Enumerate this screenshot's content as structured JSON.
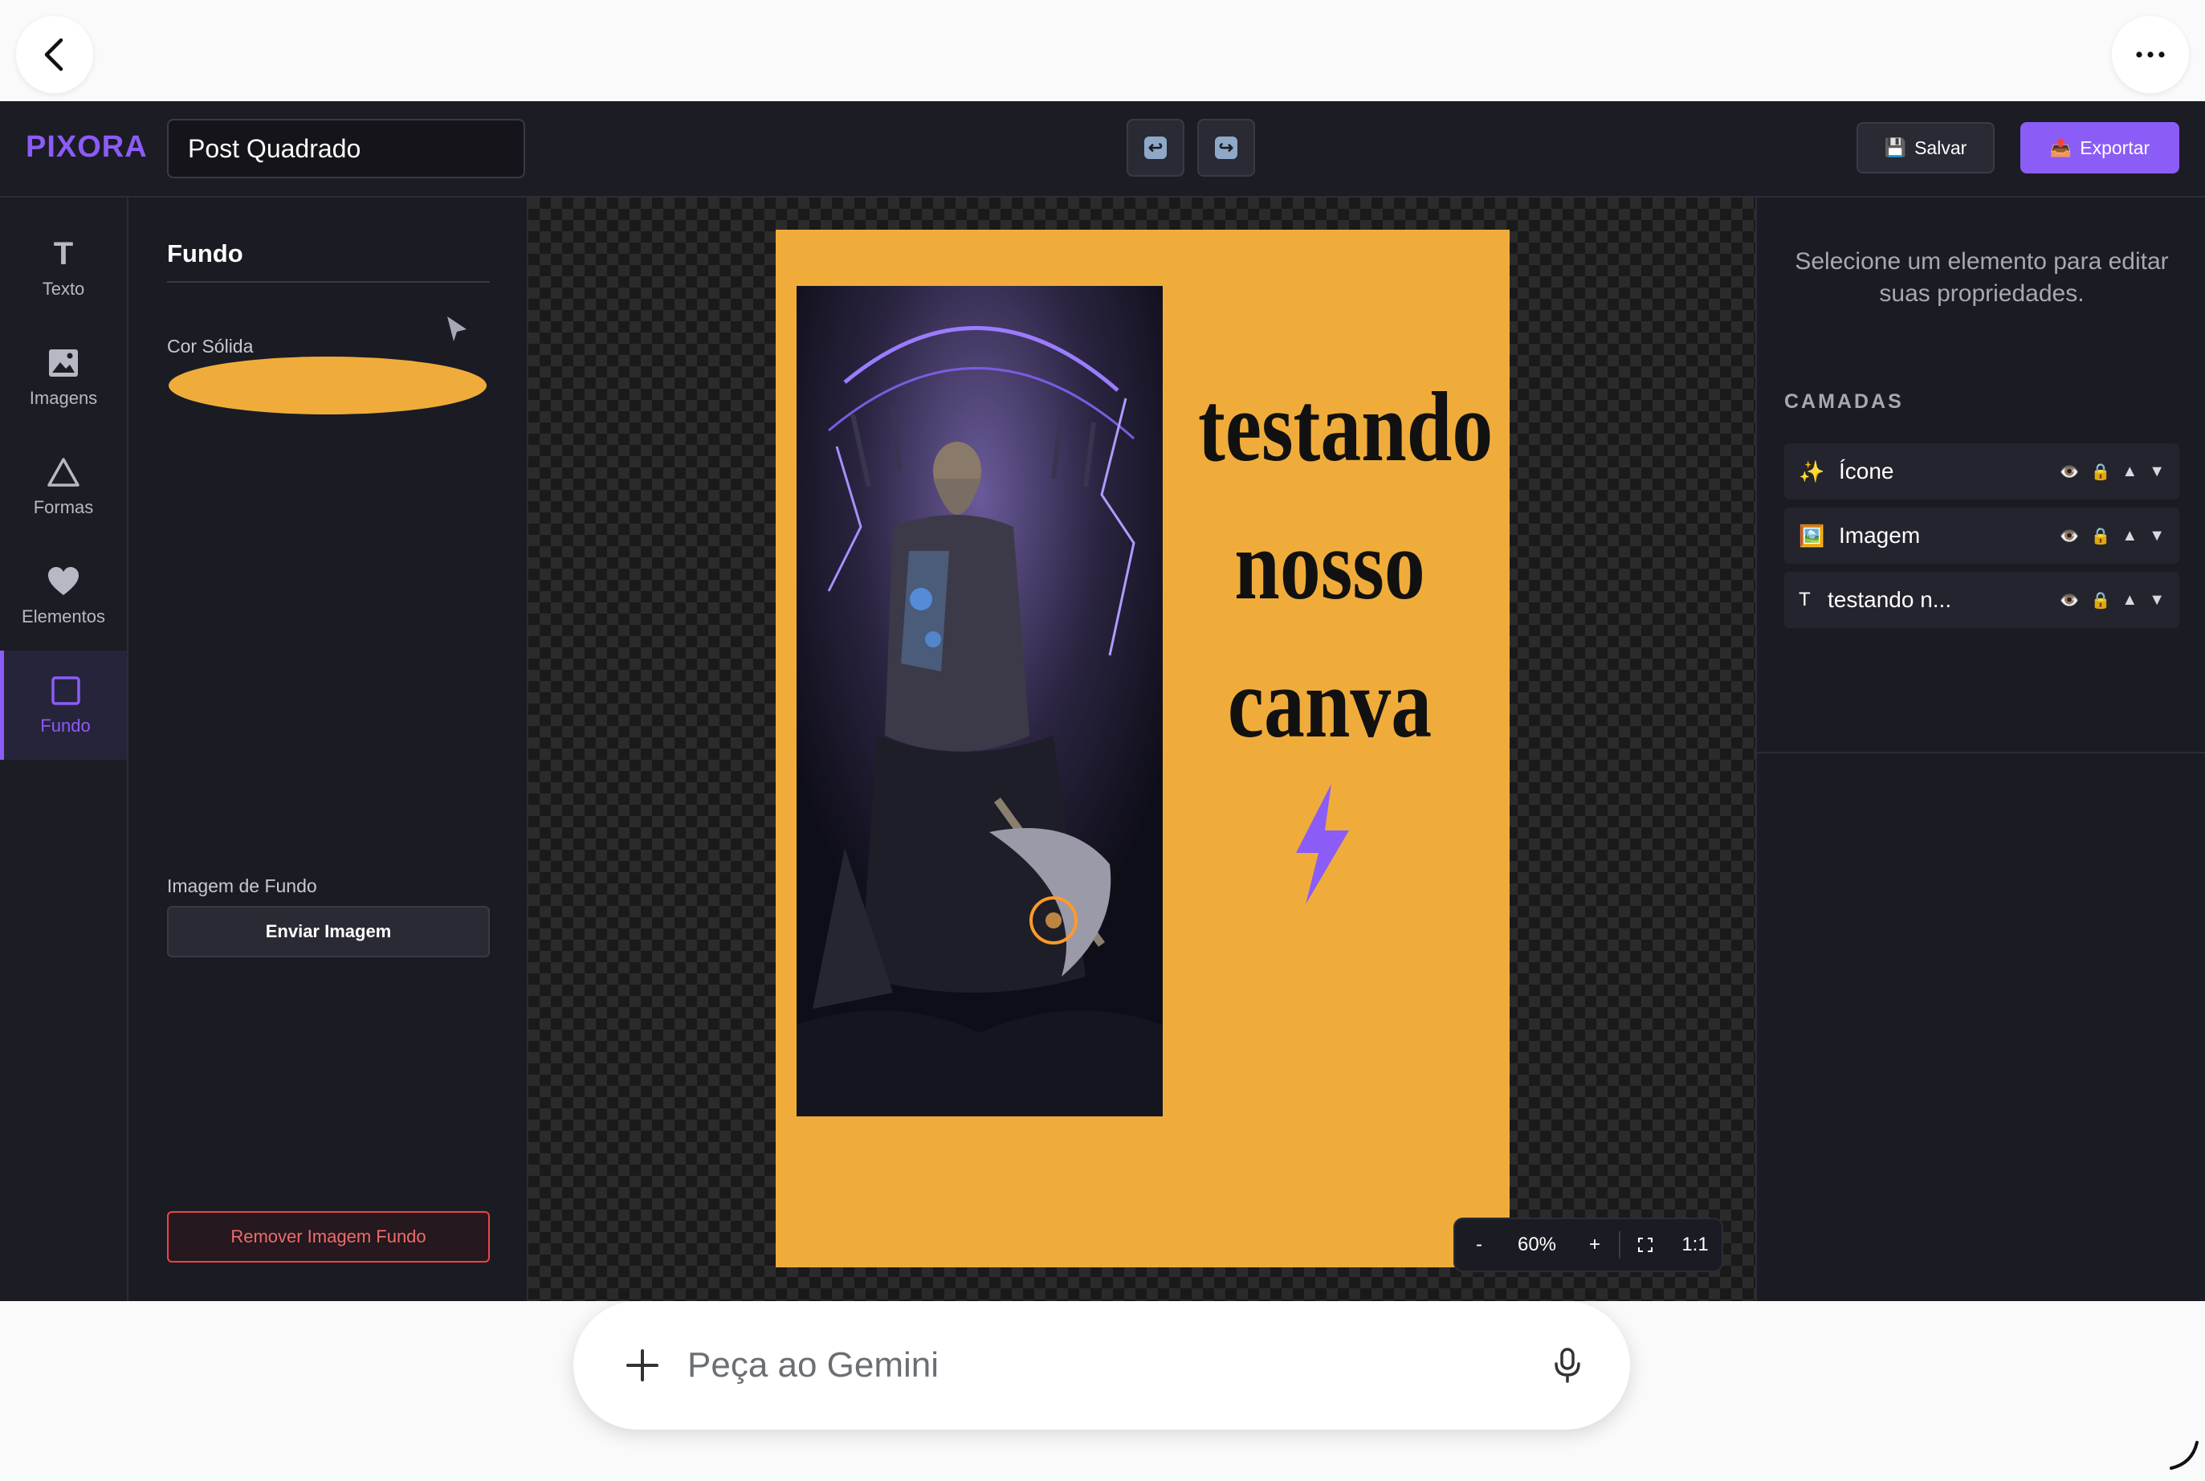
{
  "browser": {
    "back_label": "back",
    "more_label": "more options"
  },
  "app": {
    "logo": "PIXORA",
    "document_title": "Post Quadrado",
    "save_label": "Salvar",
    "export_label": "Exportar",
    "save_emoji": "💾",
    "export_emoji": "📤"
  },
  "tools": [
    {
      "label": "Texto",
      "icon": "text-icon",
      "glyph": "T"
    },
    {
      "label": "Imagens",
      "icon": "image-icon"
    },
    {
      "label": "Formas",
      "icon": "triangle-icon"
    },
    {
      "label": "Elementos",
      "icon": "heart-icon"
    },
    {
      "label": "Fundo",
      "icon": "square-icon",
      "active": true
    }
  ],
  "panel": {
    "title": "Fundo",
    "solid_color_label": "Cor Sólida",
    "solid_color": "#f0ac3a",
    "bg_image_label": "Imagem de Fundo",
    "upload_label": "Enviar Imagem",
    "remove_label": "Remover Imagem Fundo"
  },
  "canvas": {
    "background": "#f0ac3a",
    "text_lines": [
      "testando",
      "nosso",
      "canva"
    ],
    "bolt_color": "#8b5cf6",
    "zoom": {
      "minus": "-",
      "value": "60%",
      "plus": "+",
      "one_to_one": "1:1"
    }
  },
  "properties": {
    "hint": "Selecione um elemento para editar suas propriedades.",
    "layers_title": "CAMADAS",
    "layers": [
      {
        "icon": "✨",
        "name": "Ícone"
      },
      {
        "icon": "🖼️",
        "name": "Imagem"
      },
      {
        "icon": "T",
        "name": "testando n..."
      }
    ],
    "eye": "👁️",
    "lock": "🔒",
    "up": "▲",
    "down": "▼"
  },
  "gemini": {
    "placeholder": "Peça ao Gemini"
  },
  "colors": {
    "accent": "#8b5cf6",
    "danger": "#ef4444"
  }
}
